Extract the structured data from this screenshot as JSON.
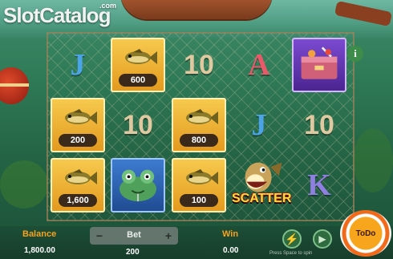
{
  "logo": {
    "text": "SlotCatalog",
    "suffix": ".com"
  },
  "info_button": {
    "label": "i"
  },
  "reels": [
    [
      {
        "type": "letter",
        "symbol": "J",
        "style": "l-j"
      },
      {
        "type": "fish",
        "style": "gold",
        "value": "200"
      },
      {
        "type": "fish",
        "style": "gold",
        "value": "1,600"
      }
    ],
    [
      {
        "type": "fish",
        "style": "gold",
        "value": "600"
      },
      {
        "type": "letter",
        "symbol": "10",
        "style": "l-10"
      },
      {
        "type": "frog",
        "style": "blue"
      }
    ],
    [
      {
        "type": "letter",
        "symbol": "10",
        "style": "l-10"
      },
      {
        "type": "fish",
        "style": "gold",
        "value": "800"
      },
      {
        "type": "fish",
        "style": "gold",
        "value": "100"
      }
    ],
    [
      {
        "type": "letter",
        "symbol": "A",
        "style": "l-a"
      },
      {
        "type": "letter",
        "symbol": "J",
        "style": "l-j"
      },
      {
        "type": "scatter",
        "label": "SCATTER"
      }
    ],
    [
      {
        "type": "tackle-box",
        "style": "purple"
      },
      {
        "type": "letter",
        "symbol": "10",
        "style": "l-10"
      },
      {
        "type": "letter",
        "symbol": "K",
        "style": "l-k"
      }
    ]
  ],
  "controls": {
    "balance_label": "Balance",
    "balance_value": "1,800.00",
    "bet_label": "Bet",
    "bet_minus": "−",
    "bet_plus": "+",
    "bet_value": "200",
    "win_label": "Win",
    "win_value": "0.00",
    "spin_label": "ToDo",
    "hint": "Press Space to spin"
  },
  "colors": {
    "accent": "#f7a21d",
    "gold_tile": "#e39a1f",
    "net": "#d2c8a0"
  }
}
